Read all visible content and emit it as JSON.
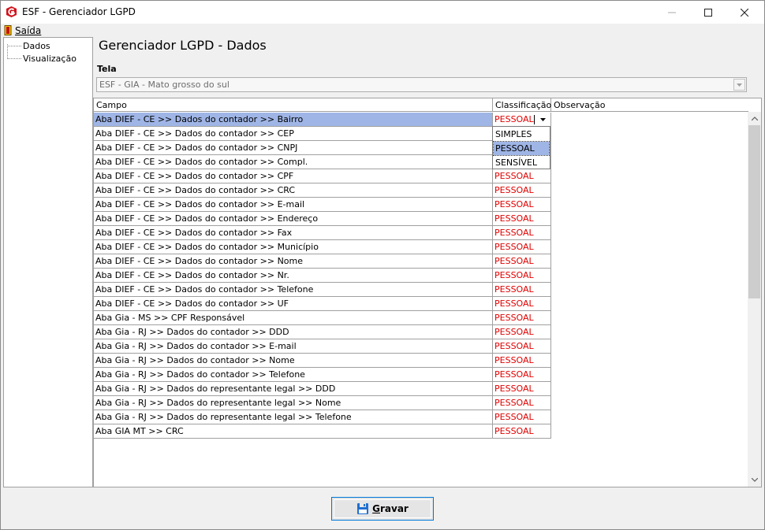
{
  "window": {
    "title": "ESF - Gerenciador LGPD",
    "icons": {
      "app": "app-logo-icon",
      "minimize": "minimize-icon",
      "maximize": "maximize-icon",
      "close": "close-icon"
    }
  },
  "menu": {
    "exit_label": "Saída",
    "exit_icon": "exit-door-icon"
  },
  "tree": {
    "items": [
      "Dados",
      "Visualização"
    ]
  },
  "panel": {
    "title": "Gerenciador LGPD - Dados",
    "tela_label": "Tela",
    "tela_value": "ESF - GIA - Mato grosso do sul"
  },
  "grid": {
    "columns": [
      "Campo",
      "Classificação",
      "Observação"
    ],
    "rows": [
      {
        "campo": "Aba DIEF - CE >> Dados do contador >> Bairro",
        "classificacao": "PESSOAL",
        "observacao": ""
      },
      {
        "campo": "Aba DIEF - CE >> Dados do contador >> CEP",
        "classificacao": "",
        "observacao": ""
      },
      {
        "campo": "Aba DIEF - CE >> Dados do contador >> CNPJ",
        "classificacao": "",
        "observacao": ""
      },
      {
        "campo": "Aba DIEF - CE >> Dados do contador >> Compl.",
        "classificacao": "",
        "observacao": ""
      },
      {
        "campo": "Aba DIEF - CE >> Dados do contador >> CPF",
        "classificacao": "PESSOAL",
        "observacao": ""
      },
      {
        "campo": "Aba DIEF - CE >> Dados do contador >> CRC",
        "classificacao": "PESSOAL",
        "observacao": ""
      },
      {
        "campo": "Aba DIEF - CE >> Dados do contador >> E-mail",
        "classificacao": "PESSOAL",
        "observacao": ""
      },
      {
        "campo": "Aba DIEF - CE >> Dados do contador >> Endereço",
        "classificacao": "PESSOAL",
        "observacao": ""
      },
      {
        "campo": "Aba DIEF - CE >> Dados do contador >> Fax",
        "classificacao": "PESSOAL",
        "observacao": ""
      },
      {
        "campo": "Aba DIEF - CE >> Dados do contador >> Município",
        "classificacao": "PESSOAL",
        "observacao": ""
      },
      {
        "campo": "Aba DIEF - CE >> Dados do contador >> Nome",
        "classificacao": "PESSOAL",
        "observacao": ""
      },
      {
        "campo": "Aba DIEF - CE >> Dados do contador >> Nr.",
        "classificacao": "PESSOAL",
        "observacao": ""
      },
      {
        "campo": "Aba DIEF - CE >> Dados do contador >> Telefone",
        "classificacao": "PESSOAL",
        "observacao": ""
      },
      {
        "campo": "Aba DIEF - CE >> Dados do contador >> UF",
        "classificacao": "PESSOAL",
        "observacao": ""
      },
      {
        "campo": "Aba Gia - MS >> CPF Responsável",
        "classificacao": "PESSOAL",
        "observacao": ""
      },
      {
        "campo": "Aba Gia - RJ >> Dados do contador >> DDD",
        "classificacao": "PESSOAL",
        "observacao": ""
      },
      {
        "campo": "Aba Gia - RJ >> Dados do contador >> E-mail",
        "classificacao": "PESSOAL",
        "observacao": ""
      },
      {
        "campo": "Aba Gia - RJ >> Dados do contador >> Nome",
        "classificacao": "PESSOAL",
        "observacao": ""
      },
      {
        "campo": "Aba Gia - RJ >> Dados do contador >> Telefone",
        "classificacao": "PESSOAL",
        "observacao": ""
      },
      {
        "campo": "Aba Gia - RJ >> Dados do representante legal >> DDD",
        "classificacao": "PESSOAL",
        "observacao": ""
      },
      {
        "campo": "Aba Gia - RJ >> Dados do representante legal >> Nome",
        "classificacao": "PESSOAL",
        "observacao": ""
      },
      {
        "campo": "Aba Gia - RJ >> Dados do representante legal >> Telefone",
        "classificacao": "PESSOAL",
        "observacao": ""
      },
      {
        "campo": "Aba GIA MT >> CRC",
        "classificacao": "PESSOAL",
        "observacao": ""
      }
    ],
    "dropdown_options": [
      "SIMPLES",
      "PESSOAL",
      "SENSÍVEL"
    ],
    "dropdown_selected": "PESSOAL"
  },
  "footer": {
    "save_label_first": "G",
    "save_label_rest": "ravar",
    "save_icon": "floppy-disk-icon"
  },
  "colors": {
    "selection": "#9fb5e6",
    "classification_text": "#e00000",
    "app_icon_red": "#d0121b"
  }
}
